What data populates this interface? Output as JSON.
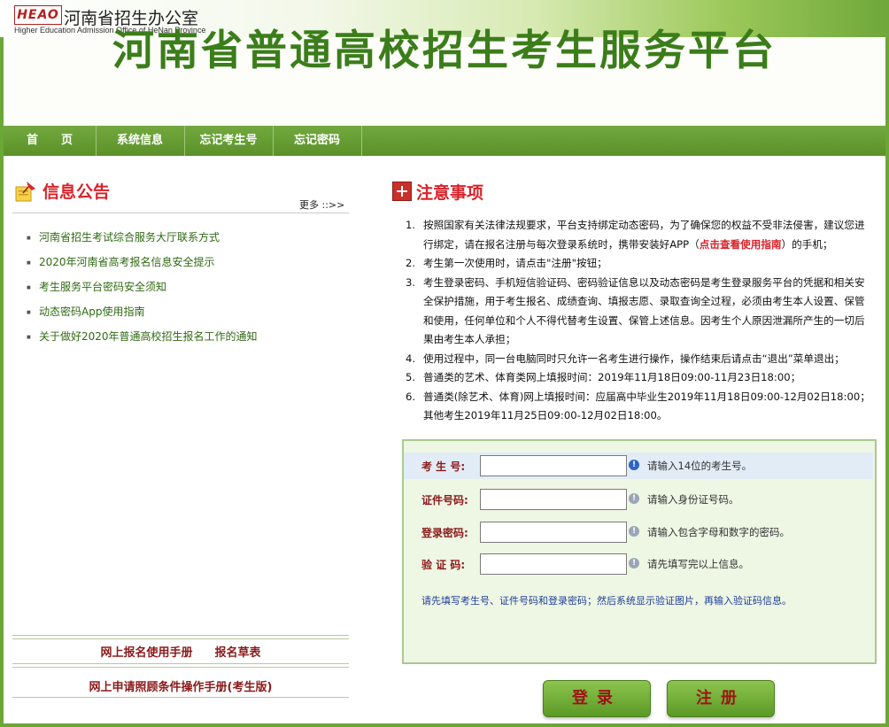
{
  "header": {
    "logo_text": "HEAO",
    "office_cn": "河南省招生办公室",
    "office_en": "Higher Education Admission Office of HeNan Province"
  },
  "banner": {
    "title": "河南省普通高校招生考生服务平台"
  },
  "nav": {
    "items": [
      {
        "label": "首　　页"
      },
      {
        "label": "系统信息"
      },
      {
        "label": "忘记考生号"
      },
      {
        "label": "忘记密码"
      }
    ]
  },
  "notices": {
    "title": "信息公告",
    "more": "更多 ::>>",
    "items": [
      "河南省招生考试综合服务大厅联系方式",
      "2020年河南省高考报名信息安全提示",
      "考生服务平台密码安全须知",
      "动态密码App使用指南",
      "关于做好2020年普通高校招生报名工作的通知"
    ]
  },
  "manuals": {
    "manual_link": "网上报名使用手册",
    "form_link": "报名草表",
    "care_manual": "网上申请照顾条件操作手册(考生版)"
  },
  "attention": {
    "title": "注意事项",
    "items": [
      {
        "num": "1.",
        "text_before": "按照国家有关法律法规要求，平台支持绑定动态密码，为了确保您的权益不受非法侵害，建议您进行绑定，请在报名注册与每次登录系统时，携带安装好APP（",
        "link": "点击查看使用指南",
        "text_after": "）的手机；"
      },
      {
        "num": "2.",
        "text": "考生第一次使用时，请点击\"注册\"按钮；"
      },
      {
        "num": "3.",
        "text": "考生登录密码、手机短信验证码、密码验证信息以及动态密码是考生登录服务平台的凭据和相关安全保护措施，用于考生报名、成绩查询、填报志愿、录取查询全过程，必须由考生本人设置、保管和使用，任何单位和个人不得代替考生设置、保管上述信息。因考生个人原因泄漏所产生的一切后果由考生本人承担；"
      },
      {
        "num": "4.",
        "text": "使用过程中，同一台电脑同时只允许一名考生进行操作，操作结束后请点击“退出”菜单退出；"
      },
      {
        "num": "5.",
        "text": "普通类的艺术、体育类网上填报时间：2019年11月18日09:00-11月23日18:00；"
      },
      {
        "num": "6.",
        "text": "普通类(除艺术、体育)网上填报时间：应届高中毕业生2019年11月18日09:00-12月02日18:00；其他考生2019年11月25日09:00-12月02日18:00。"
      }
    ]
  },
  "login": {
    "fields": [
      {
        "label": "考 生 号:",
        "value": "",
        "placeholder": "",
        "hint": "请输入14位的考生号。"
      },
      {
        "label": "证件号码:",
        "value": "",
        "placeholder": "",
        "hint": "请输入身份证号码。"
      },
      {
        "label": "登录密码:",
        "value": "",
        "placeholder": "",
        "hint": "请输入包含字母和数字的密码。"
      },
      {
        "label": "验 证 码:",
        "value": "",
        "placeholder": "",
        "hint": "请先填写完以上信息。"
      }
    ],
    "tip": "请先填写考生号、证件号码和登录密码；然后系统显示验证图片，再输入验证码信息。",
    "login_button": "登录",
    "register_button": "注册"
  },
  "colors": {
    "brand_green": "#3b7d1a",
    "nav_green": "#5b9128",
    "accent_red": "#d8232a"
  }
}
